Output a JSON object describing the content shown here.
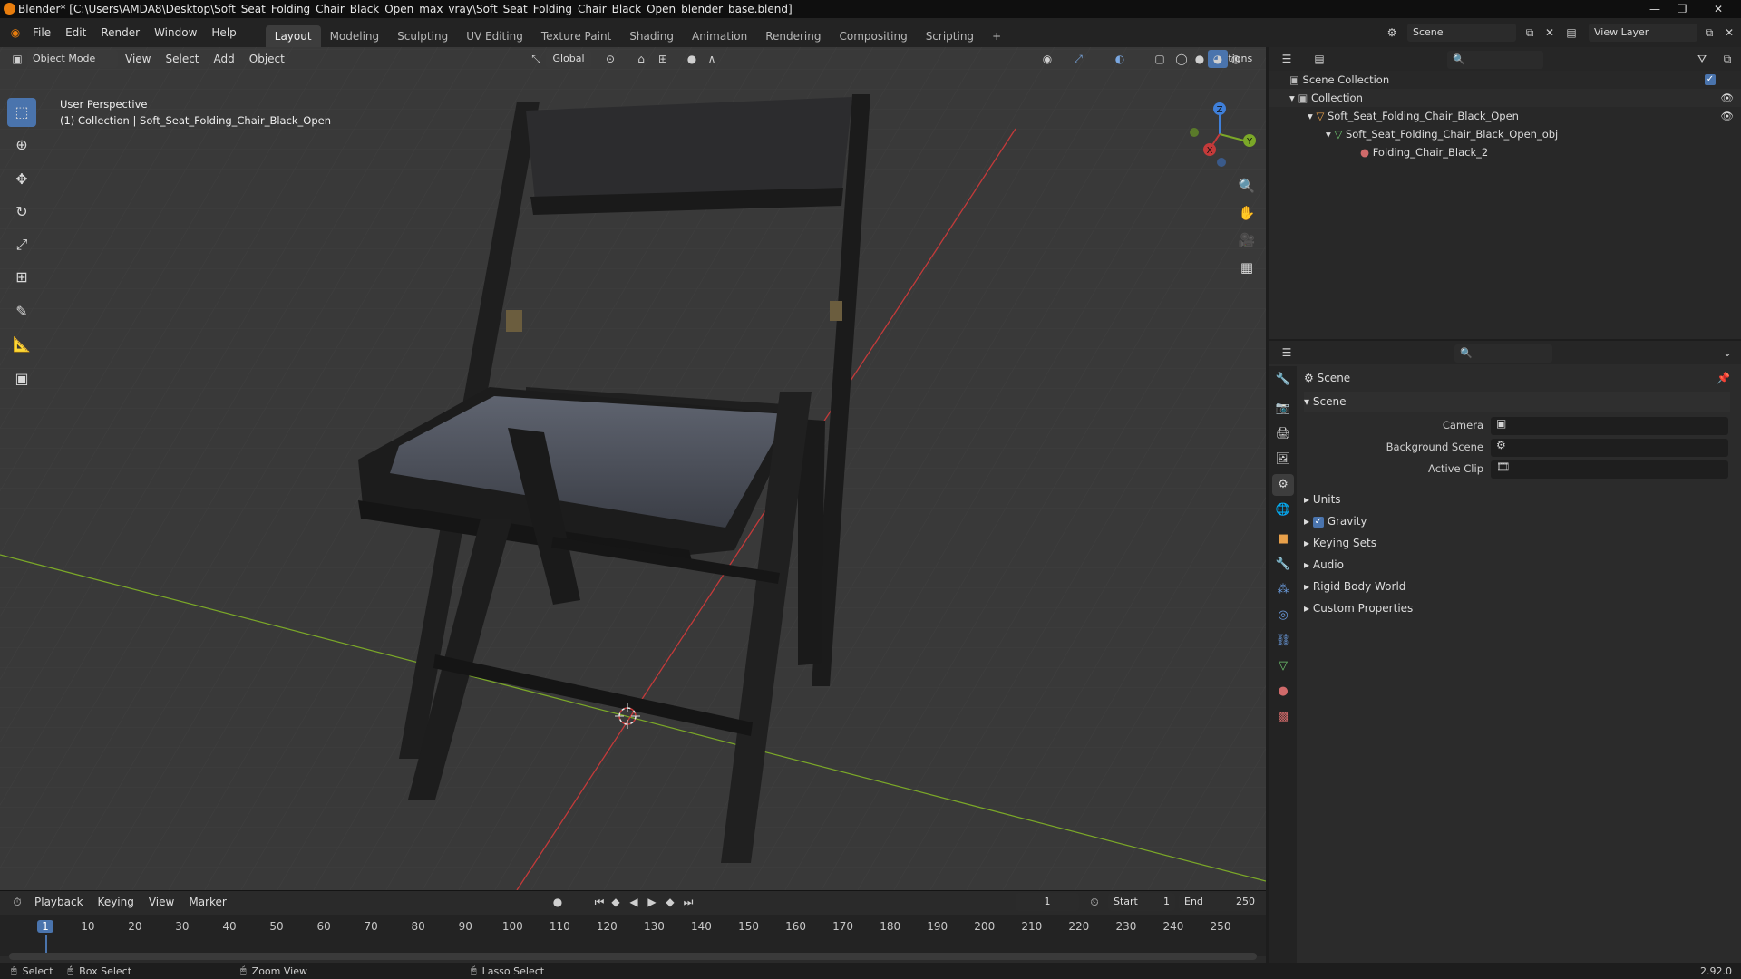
{
  "window": {
    "title": "Blender* [C:\\Users\\AMDA8\\Desktop\\Soft_Seat_Folding_Chair_Black_Open_max_vray\\Soft_Seat_Folding_Chair_Black_Open_blender_base.blend]"
  },
  "menu": {
    "items": [
      "File",
      "Edit",
      "Render",
      "Window",
      "Help"
    ]
  },
  "workspaces": [
    "Layout",
    "Modeling",
    "Sculpting",
    "UV Editing",
    "Texture Paint",
    "Shading",
    "Animation",
    "Rendering",
    "Compositing",
    "Scripting"
  ],
  "active_workspace": "Layout",
  "scene_selector": {
    "label": "Scene"
  },
  "view_layer": {
    "label": "View Layer"
  },
  "viewport_header": {
    "mode": "Object Mode",
    "menus": [
      "View",
      "Select",
      "Add",
      "Object"
    ],
    "transform_orientation": "Global",
    "options_label": "Options"
  },
  "viewport_overlay": {
    "line1": "User Perspective",
    "line2": "(1) Collection | Soft_Seat_Folding_Chair_Black_Open"
  },
  "gizmo": {
    "x": "X",
    "y": "Y",
    "z": "Z"
  },
  "outliner": {
    "root": "Scene Collection",
    "collection": "Collection",
    "object": "Soft_Seat_Folding_Chair_Black_Open",
    "mesh": "Soft_Seat_Folding_Chair_Black_Open_obj",
    "material": "Folding_Chair_Black_2"
  },
  "properties": {
    "context": "Scene",
    "section": "Scene",
    "camera_label": "Camera",
    "background_scene_label": "Background Scene",
    "active_clip_label": "Active Clip",
    "panels": [
      "Units",
      "Gravity",
      "Keying Sets",
      "Audio",
      "Rigid Body World",
      "Custom Properties"
    ]
  },
  "timeline": {
    "menus": [
      "Playback",
      "Keying",
      "View",
      "Marker"
    ],
    "current_frame": "1",
    "start_label": "Start",
    "start": "1",
    "end_label": "End",
    "end": "250",
    "ticks": [
      "1",
      "10",
      "20",
      "30",
      "40",
      "50",
      "60",
      "70",
      "80",
      "90",
      "100",
      "110",
      "120",
      "130",
      "140",
      "150",
      "160",
      "170",
      "180",
      "190",
      "200",
      "210",
      "220",
      "230",
      "240",
      "250"
    ]
  },
  "statusbar": {
    "select": "Select",
    "box_select": "Box Select",
    "zoom_view": "Zoom View",
    "lasso_select": "Lasso Select",
    "version": "2.92.0"
  },
  "colors": {
    "accent": "#4a74ad",
    "x_axis": "#c43a3a",
    "y_axis": "#7ba828",
    "z_axis": "#3f7fd9"
  }
}
